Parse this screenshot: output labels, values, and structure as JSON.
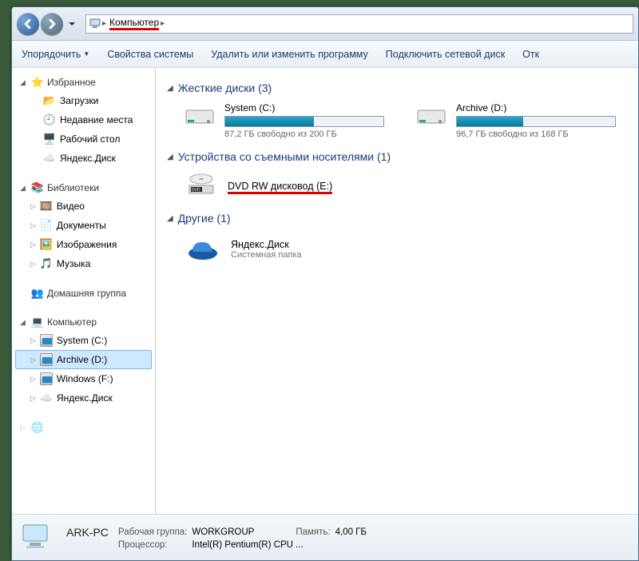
{
  "breadcrumb": {
    "item": "Компьютер"
  },
  "toolbar": {
    "organize": "Упорядочить",
    "props": "Свойства системы",
    "uninstall": "Удалить или изменить программу",
    "netdrive": "Подключить сетевой диск",
    "open_trunc": "Отк"
  },
  "sidebar": {
    "favorites": {
      "label": "Избранное",
      "items": [
        "Загрузки",
        "Недавние места",
        "Рабочий стол",
        "Яндекс.Диск"
      ]
    },
    "libraries": {
      "label": "Библиотеки",
      "items": [
        "Видео",
        "Документы",
        "Изображения",
        "Музыка"
      ]
    },
    "homegroup": {
      "label": "Домашняя группа"
    },
    "computer": {
      "label": "Компьютер",
      "items": [
        "System (C:)",
        "Archive (D:)",
        "Windows (F:)",
        "Яндекс.Диск"
      ]
    }
  },
  "main": {
    "group_hdd": {
      "title": "Жесткие диски (3)",
      "drives": [
        {
          "name": "System (C:)",
          "sub": "87,2 ГБ свободно из 200 ГБ",
          "fill_pct": 56
        },
        {
          "name": "Archive (D:)",
          "sub": "96,7 ГБ свободно из 168 ГБ",
          "fill_pct": 42
        }
      ]
    },
    "group_removable": {
      "title": "Устройства со съемными носителями (1)",
      "item": {
        "name": "DVD RW дисковод (E:)"
      }
    },
    "group_other": {
      "title": "Другие (1)",
      "item": {
        "name": "Яндекс.Диск",
        "sub": "Системная папка"
      }
    }
  },
  "details": {
    "name": "ARK-PC",
    "k_workgroup": "Рабочая группа:",
    "v_workgroup": "WORKGROUP",
    "k_mem": "Память:",
    "v_mem": "4,00 ГБ",
    "k_cpu": "Процессор:",
    "v_cpu": "Intel(R) Pentium(R) CPU ..."
  }
}
